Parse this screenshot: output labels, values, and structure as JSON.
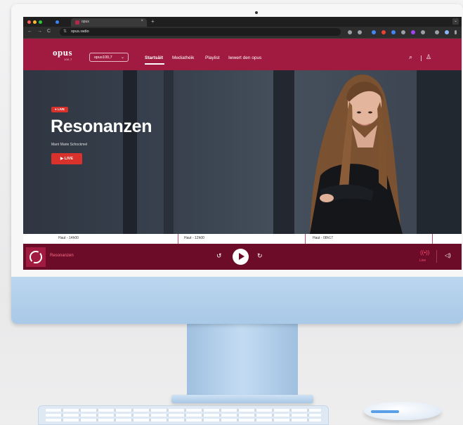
{
  "browser": {
    "tab_title": "opus",
    "tab_close": "×",
    "new_tab": "+",
    "tabs_menu": "⌄",
    "url": "opus.radio",
    "nav_back": "←",
    "nav_forward": "→",
    "nav_reload": "C",
    "site_info_icon": "⇅"
  },
  "site": {
    "logo": "opus",
    "logo_sub": "100,7",
    "station_select": "opus100,7",
    "station_chevron": "⌄",
    "menu": [
      {
        "label": "Startsäit"
      },
      {
        "label": "Mediathéik"
      },
      {
        "label": "Playlist"
      },
      {
        "label": "Iwwert den opus"
      }
    ],
    "search_icon": "⌕",
    "user_icon": "♙"
  },
  "hero": {
    "badge": "● LIVE",
    "title": "Resonanzen",
    "host": "Marri Marie Schockmel",
    "live_button": "▶ LIVE"
  },
  "schedule": [
    {
      "label": "Haut - 14h00"
    },
    {
      "label": "Haut - 12h00"
    },
    {
      "label": "Haut - 08h17"
    }
  ],
  "player": {
    "title": "Resonanzen",
    "rewind_icon": "↺",
    "forward_icon": "↻",
    "live_icon": "((•))",
    "live_label": "Live",
    "volume_icon": "◁)"
  },
  "colors": {
    "brand": "#a11a3f",
    "player_bg": "#6c0c28",
    "live_red": "#d9322c"
  }
}
